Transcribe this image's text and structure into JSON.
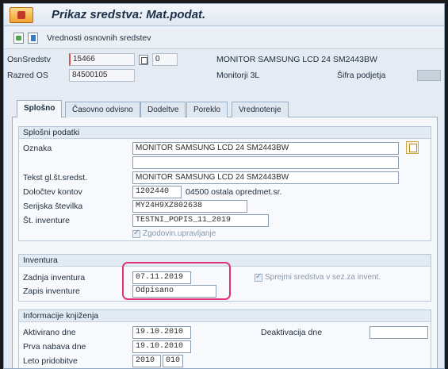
{
  "title": "Prikaz sredstva: Mat.podat.",
  "toolbar": {
    "label": "Vrednosti osnovnih sredstev"
  },
  "header": {
    "osn_label": "OsnSredstv",
    "osn_value": "15466",
    "sub_value": "0",
    "description": "MONITOR SAMSUNG LCD 24 SM2443BW",
    "razred_label": "Razred OS",
    "razred_value": "84500105",
    "razred_desc": "Monitorji 3L",
    "sifra_label": "Šifra podjetja"
  },
  "tabs": [
    "Splošno",
    "Časovno odvisno",
    "Dodeltve",
    "Poreklo",
    "Vrednotenje"
  ],
  "splosni": {
    "title": "Splošni podatki",
    "oznaka_label": "Oznaka",
    "oznaka_value": "MONITOR SAMSUNG LCD 24 SM2443BW",
    "oznaka2_value": "",
    "tekst_label": "Tekst gl.št.sredst.",
    "tekst_value": "MONITOR SAMSUNG LCD 24 SM2443BW",
    "dolocitev_label": "Določtev kontov",
    "dolocitev_value": "1202440",
    "dolocitev_desc": "04500 ostala opredmet.sr.",
    "serijska_label": "Serijska številka",
    "serijska_value": "MY24H9XZ802638",
    "inventure_label": "Št. inventure",
    "inventure_value": "TESTNI_POPIS_11_2019",
    "zgodovin_label": "Zgodovin.upravljanje"
  },
  "inventura": {
    "title": "Inventura",
    "zadnja_label": "Zadnja inventura",
    "zadnja_value": "07.11.2019",
    "zapis_label": "Zapis inventure",
    "zapis_value": "Odpisano",
    "sprejmi_label": "Sprejmi sredstva v sez.za invent."
  },
  "knjizenje": {
    "title": "Informacije knjiženja",
    "aktivirano_label": "Aktivirano dne",
    "aktivirano_value": "19.10.2010",
    "prva_label": "Prva nabava dne",
    "prva_value": "19.10.2010",
    "leto_label": "Leto pridobitve",
    "leto_value": "2010",
    "leto_period": "010",
    "deakt_label": "Deaktivacija dne"
  }
}
